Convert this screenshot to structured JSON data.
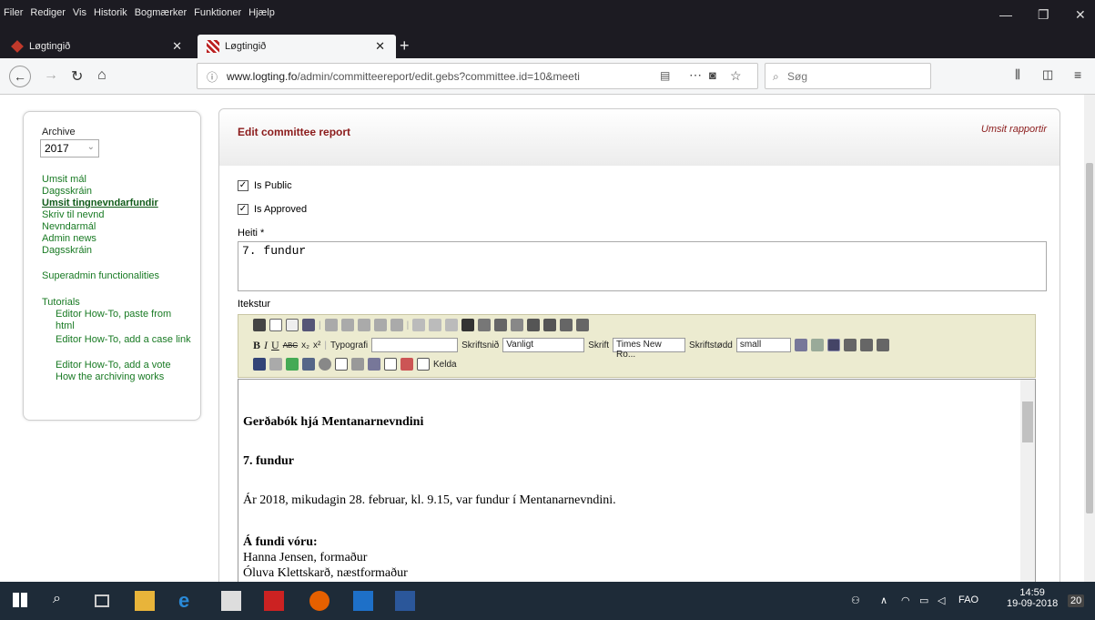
{
  "menubar": [
    "Filer",
    "Rediger",
    "Vis",
    "Historik",
    "Bogmærker",
    "Funktioner",
    "Hjælp"
  ],
  "tabs": [
    {
      "title": "Løgtingið"
    },
    {
      "title": "Løgtingið"
    }
  ],
  "url": {
    "domain": "www.logting.fo",
    "path": "/admin/committeereport/edit.gebs?committee.id=10&meeti"
  },
  "search": {
    "placeholder": "Søg"
  },
  "sidebar": {
    "archive_label": "Archive",
    "year": "2017",
    "links": [
      "Umsit mál",
      "Dagsskráin",
      "Umsit tingnevndarfundir",
      "Skriv til nevnd",
      "Nevndarmál",
      "Admin news",
      "Dagsskráin"
    ],
    "superadmin": "Superadmin functionalities",
    "tutorials_label": "Tutorials",
    "tutorials": [
      "Editor How-To, paste from html",
      "Editor How-To, add a case link",
      "Editor How-To, add a vote",
      "How the archiving works"
    ]
  },
  "main": {
    "title": "Edit committee report",
    "right_link": "Umsit rapportir",
    "is_public": "Is Public",
    "is_approved": "Is Approved",
    "heiti_label": "Heiti *",
    "heiti_value": "7. fundur",
    "itekstur_label": "Itekstur"
  },
  "toolbar": {
    "typografi": "Typografi",
    "skriftsnid": "Skriftsnið",
    "skriftsnid_value": "Vanligt",
    "skrift": "Skrift",
    "skrift_value": "Times New Ro...",
    "skriftstodd": "Skriftstødd",
    "skriftstodd_value": "small",
    "kelda": "Kelda"
  },
  "document": {
    "heading": "Gerðabók hjá Mentanarnevndini",
    "meeting": "7. fundur",
    "intro": "Ár 2018, mikudagin 28. februar, kl. 9.15, var fundur í Mentanarnevndini.",
    "present_label": "Á fundi vóru:",
    "members": [
      "Hanna Jensen, formaður",
      "Óluva Klettskarð, næstformaður"
    ]
  },
  "taskbar": {
    "lang": "FAO",
    "time": "14:59",
    "date": "19-09-2018",
    "notifications": "20"
  }
}
